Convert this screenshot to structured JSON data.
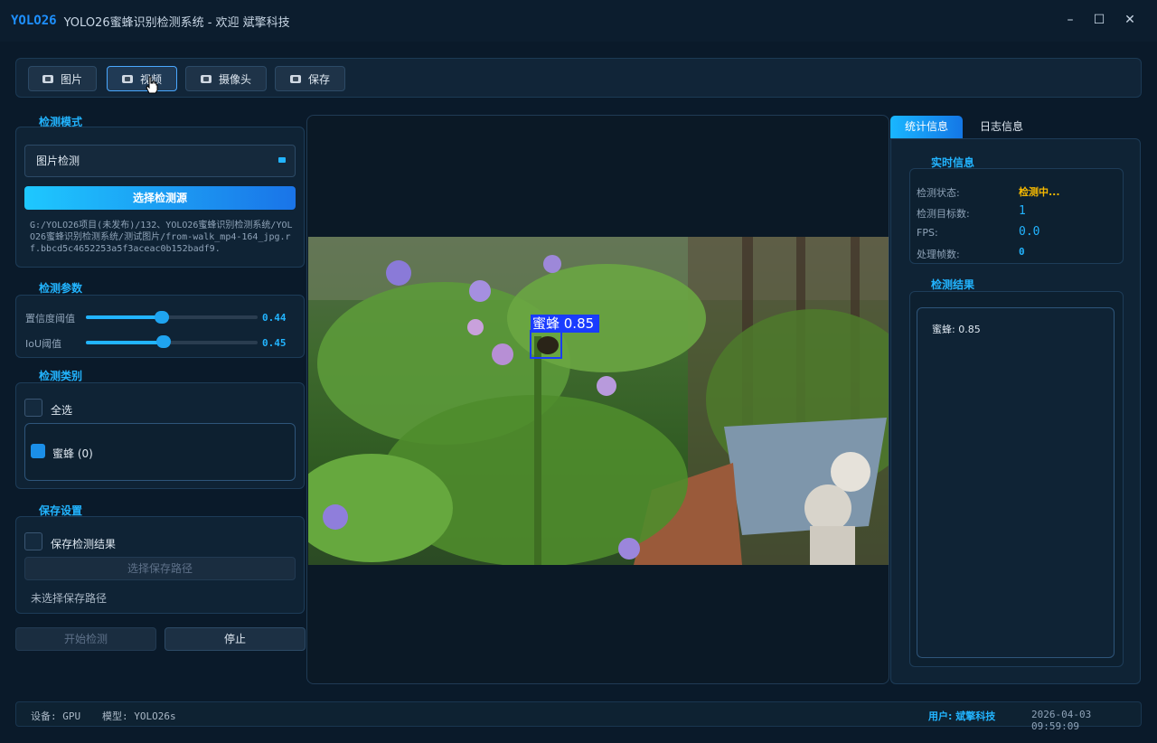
{
  "titlebar": {
    "brand": "YOLO26",
    "title": "YOLO26蜜蜂识别检测系统 - 欢迎 斌擎科技",
    "minimize": "–",
    "maximize": "☐",
    "close": "✕"
  },
  "toolbar": {
    "image": "图片",
    "video": "视频",
    "camera": "摄像头",
    "save": "保存"
  },
  "detect_mode": {
    "title": "检测模式",
    "selected": "图片检测",
    "choose_source": "选择检测源",
    "path": "G:/YOLO26项目(未发布)/132、YOLO26蜜蜂识别检测系统/YOLO26蜜蜂识别检测系统/测试图片/from-walk_mp4-164_jpg.rf.bbcd5c4652253a5f3aceac0b152badf9."
  },
  "params": {
    "title": "检测参数",
    "conf_label": "置信度阈值",
    "conf_value": "0.44",
    "iou_label": "IoU阈值",
    "iou_value": "0.45"
  },
  "classes": {
    "title": "检测类别",
    "select_all": "全选",
    "items": [
      {
        "label": "蜜蜂 (0)",
        "checked": true
      }
    ]
  },
  "save_settings": {
    "title": "保存设置",
    "save_results": "保存检测结果",
    "choose_path": "选择保存路径",
    "no_path": "未选择保存路径"
  },
  "actions": {
    "start": "开始检测",
    "stop": "停止"
  },
  "viewer": {
    "detection_label": "蜜蜂 0.85"
  },
  "tabs": {
    "stats": "统计信息",
    "log": "日志信息"
  },
  "realtime": {
    "title": "实时信息",
    "status_key": "检测状态:",
    "status_val": "检测中...",
    "count_key": "检测目标数:",
    "count_val": "1",
    "fps_key": "FPS:",
    "fps_val": "0.0",
    "frames_key": "处理帧数:",
    "frames_val": "0"
  },
  "results": {
    "title": "检测结果",
    "text": "蜜蜂: 0.85"
  },
  "statusbar": {
    "device": "设备: GPU",
    "model": "模型: YOLO26s",
    "user": "用户: 斌擎科技",
    "datetime": "2026-04-03 09:59:09"
  },
  "colors": {
    "accent": "#22b4ff",
    "status": "#f5b800",
    "bbox": "#1a3cff"
  }
}
